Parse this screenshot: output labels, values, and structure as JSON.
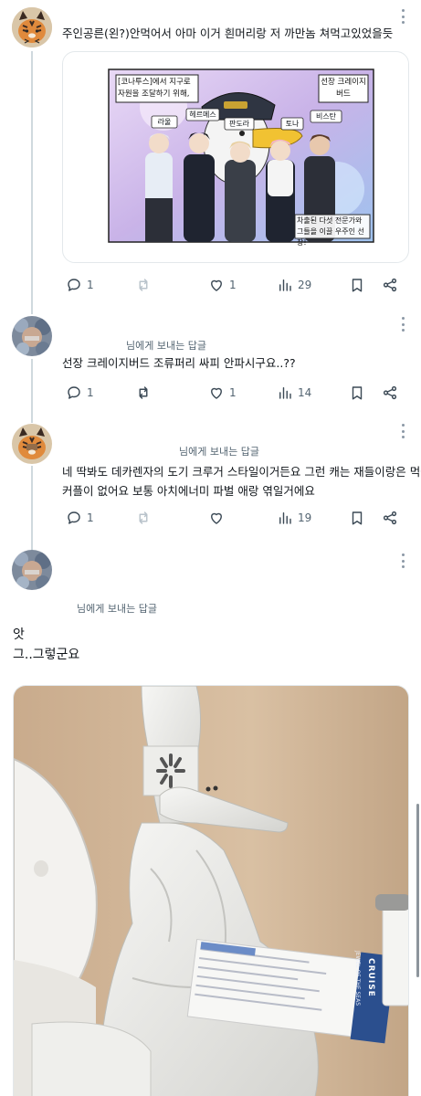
{
  "tweet1": {
    "text": "주인공른(왼?)안먹어서 아마 이거 흰머리랑 저 까만놈 쳐먹고있었을듯",
    "comic": {
      "caption_top": "[코나투스]에서 지구로 자원을 조달하기 위해,",
      "captain_label": "선장 크레이지버드",
      "names": [
        "라울",
        "헤르메스",
        "판도라",
        "토나",
        "비스탄"
      ],
      "caption_bottom": "차출된 다섯 전문가와 그들을 이끌 우주인 선장!"
    },
    "counts": {
      "reply": "1",
      "retweet": "",
      "like": "1",
      "views": "29"
    }
  },
  "tweet2": {
    "replying_to": "님에게 보내는 답글",
    "text": "선장 크레이지버드 조류퍼리 싸피 안파시구요..??",
    "counts": {
      "reply": "1",
      "retweet": "",
      "like": "1",
      "views": "14"
    }
  },
  "tweet3": {
    "replying_to": "님에게 보내는 답글",
    "text_lines": [
      "네 딱봐도 데카렌자의 도기 크루거 스타일이거든요 그런 캐는 재들이랑은 먹을",
      "커플이 없어요 보통 아치에너미 파벌 애랑 엮일거에요"
    ],
    "counts": {
      "reply": "1",
      "retweet": "",
      "like": "",
      "views": "19"
    }
  },
  "tweet4": {
    "replying_to": "님에게 보내는 답글",
    "text_lines": [
      "앗",
      "그..그렇군요"
    ],
    "photo": {
      "brochure_title": "CRUISE",
      "brochure_sub": "JEWEL OF THE SEAS"
    }
  },
  "icons": [
    "reply-icon",
    "retweet-icon",
    "like-icon",
    "views-icon",
    "bookmark-icon",
    "share-icon",
    "more-icon"
  ],
  "colors": {
    "text": "#0f1419",
    "secondary": "#536471",
    "line": "#cfd9de",
    "icon": "#3c4a56"
  }
}
